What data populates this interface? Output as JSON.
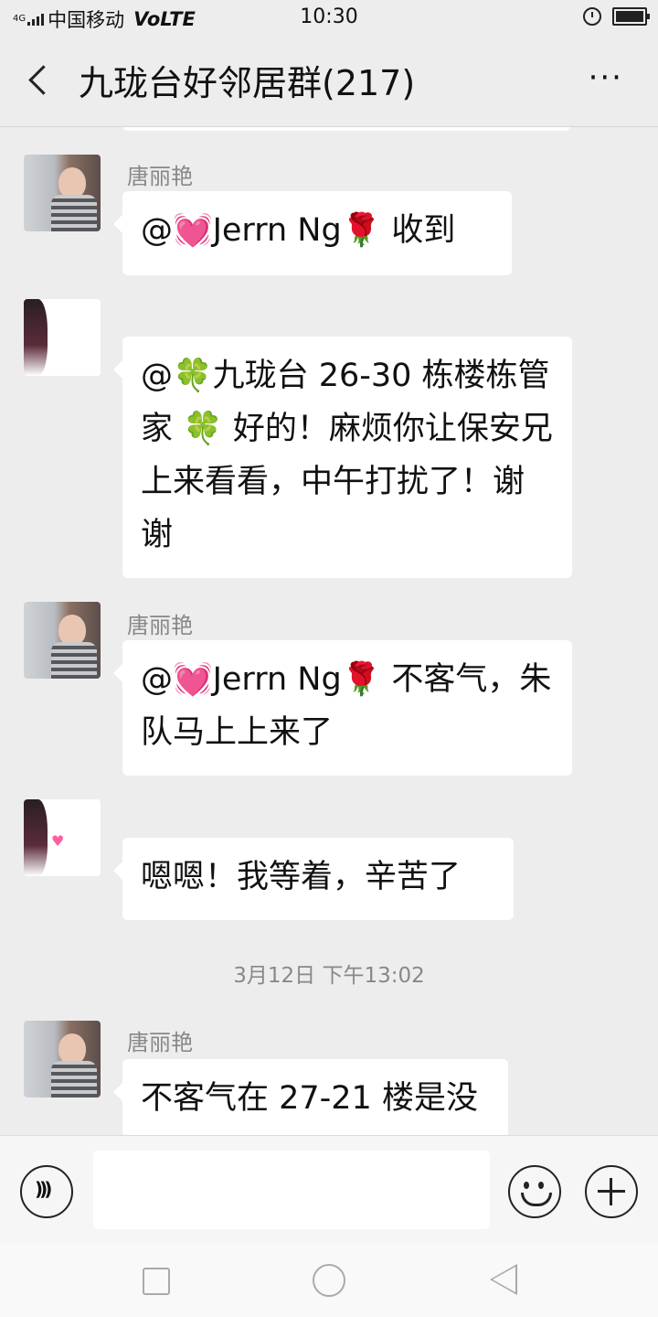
{
  "status_bar": {
    "network_type": "4G",
    "carrier": "中国移动",
    "volte": "VoLTE",
    "time": "10:30",
    "icons": [
      "signal-icon",
      "alarm-icon",
      "battery-icon"
    ]
  },
  "header": {
    "title": "九珑台好邻居群(217)",
    "more_label": "···"
  },
  "messages": [
    {
      "sender": "唐丽艳",
      "avatar": "tang-avatar",
      "text": "@💓Jerrn Ng🌹  收到"
    },
    {
      "sender": "",
      "avatar": "other-avatar",
      "text": "@🍀九珑台 26-30 栋楼栋管家 🍀 好的！麻烦你让保安兄上来看看，中午打扰了！谢谢"
    },
    {
      "sender": "唐丽艳",
      "avatar": "tang-avatar",
      "text": "@💓Jerrn Ng🌹  不客气，朱队马上上来了"
    },
    {
      "sender": "",
      "avatar": "other-avatar",
      "text": "嗯嗯！我等着，辛苦了"
    },
    {
      "sender": "唐丽艳",
      "avatar": "tang-avatar",
      "text": "不客气在 27-21 楼是没"
    }
  ],
  "timestamp": "3月12日 下午13:02",
  "input_bar": {
    "placeholder": ""
  },
  "colors": {
    "background": "#ededed",
    "bubble": "#ffffff",
    "sender_text": "#888888"
  }
}
